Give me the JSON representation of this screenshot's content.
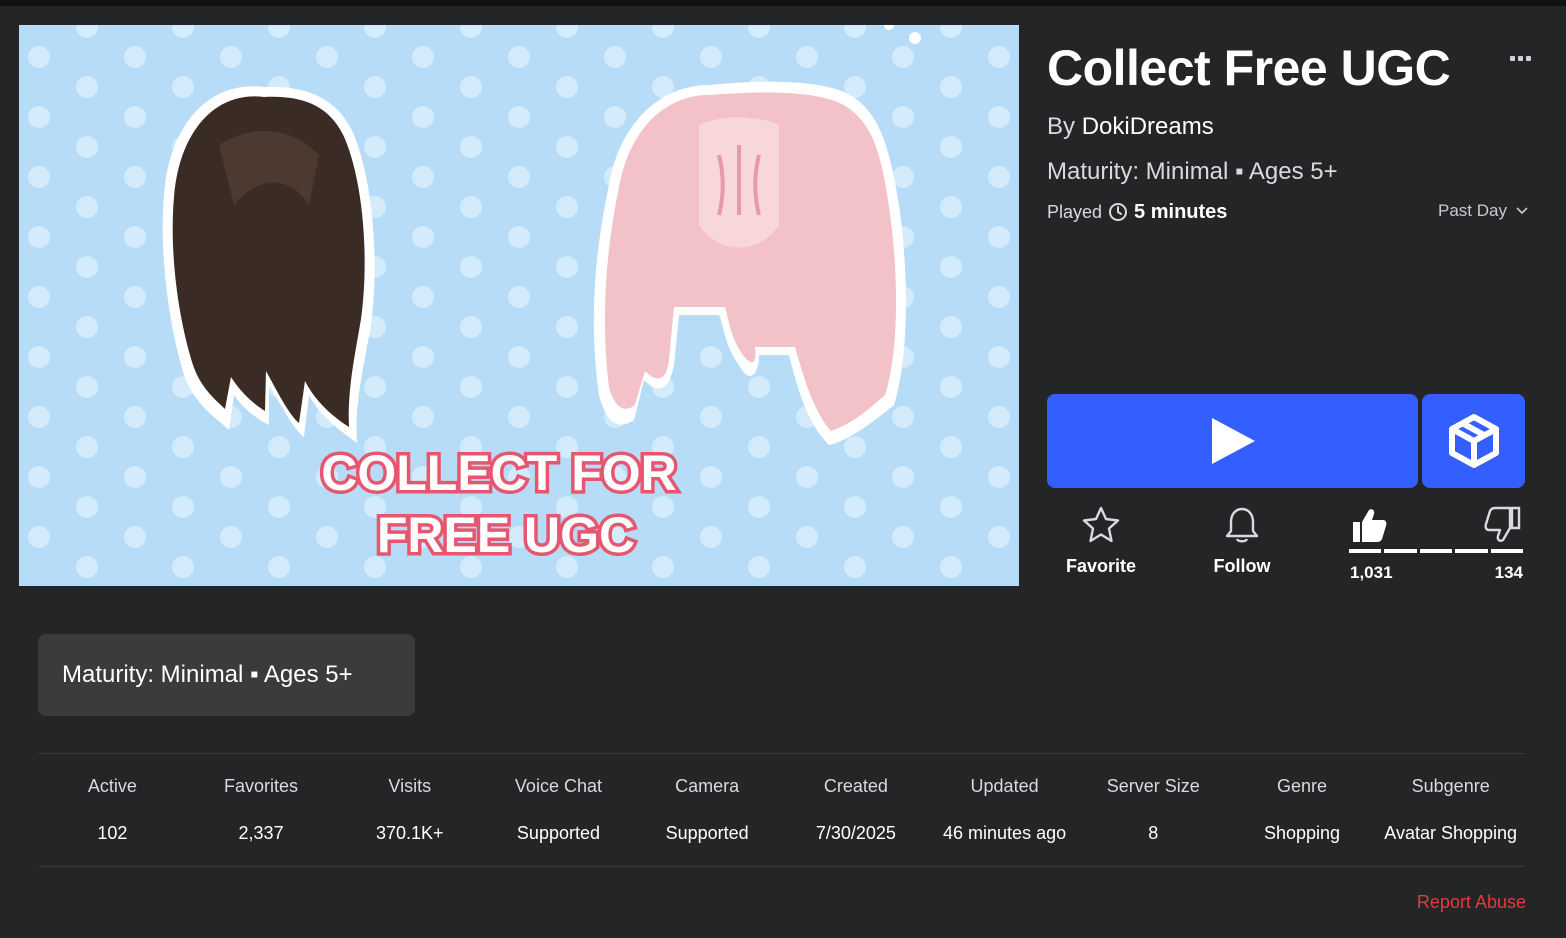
{
  "game": {
    "title": "Collect Free UGC",
    "by_prefix": "By",
    "creator": "DokiDreams",
    "maturity": "Maturity: Minimal ▪ Ages 5+",
    "played_label": "Played",
    "played_value": "5 minutes",
    "time_range": "Past Day"
  },
  "thumbnail": {
    "line1": "COLLECT FOR",
    "line2": "FREE UGC",
    "background_color": "#b7dcf7"
  },
  "actions": {
    "favorite_label": "Favorite",
    "follow_label": "Follow"
  },
  "votes": {
    "up": "1,031",
    "down": "134",
    "up_fraction": 0.885
  },
  "maturity_card": {
    "text": "Maturity: Minimal ▪ Ages 5+"
  },
  "stats": [
    {
      "label": "Active",
      "value": "102"
    },
    {
      "label": "Favorites",
      "value": "2,337"
    },
    {
      "label": "Visits",
      "value": "370.1K+"
    },
    {
      "label": "Voice Chat",
      "value": "Supported"
    },
    {
      "label": "Camera",
      "value": "Supported"
    },
    {
      "label": "Created",
      "value": "7/30/2025"
    },
    {
      "label": "Updated",
      "value": "46 minutes ago"
    },
    {
      "label": "Server Size",
      "value": "8"
    },
    {
      "label": "Genre",
      "value": "Shopping"
    },
    {
      "label": "Subgenre",
      "value": "Avatar Shopping"
    }
  ],
  "report_label": "Report Abuse",
  "colors": {
    "page_bg": "#232527",
    "play_button": "#335fff",
    "report": "#e23b3b",
    "card_bg": "#393b3d"
  }
}
